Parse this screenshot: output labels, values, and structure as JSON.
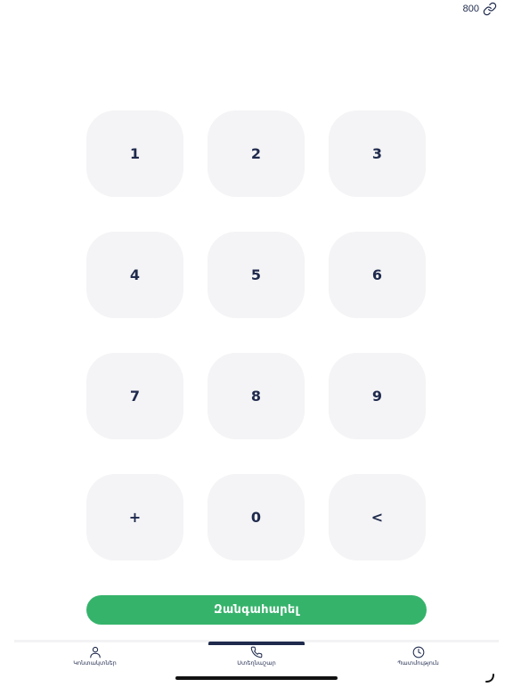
{
  "status": {
    "value": "800",
    "icon": "link-icon"
  },
  "keypad": {
    "keys": [
      "1",
      "2",
      "3",
      "4",
      "5",
      "6",
      "7",
      "8",
      "9",
      "+",
      "0",
      "<"
    ]
  },
  "call_button": {
    "label": "Զանգահարել",
    "color": "#36b36b"
  },
  "tabs": [
    {
      "label": "Կոնտակտներ",
      "icon": "person-icon",
      "active": false
    },
    {
      "label": "Ստեղնաշար",
      "icon": "phone-icon",
      "active": true
    },
    {
      "label": "Պատմություն",
      "icon": "clock-icon",
      "active": false
    }
  ],
  "colors": {
    "text": "#1f2a4d",
    "key_background": "#f4f4f6",
    "accent": "#36b36b"
  }
}
